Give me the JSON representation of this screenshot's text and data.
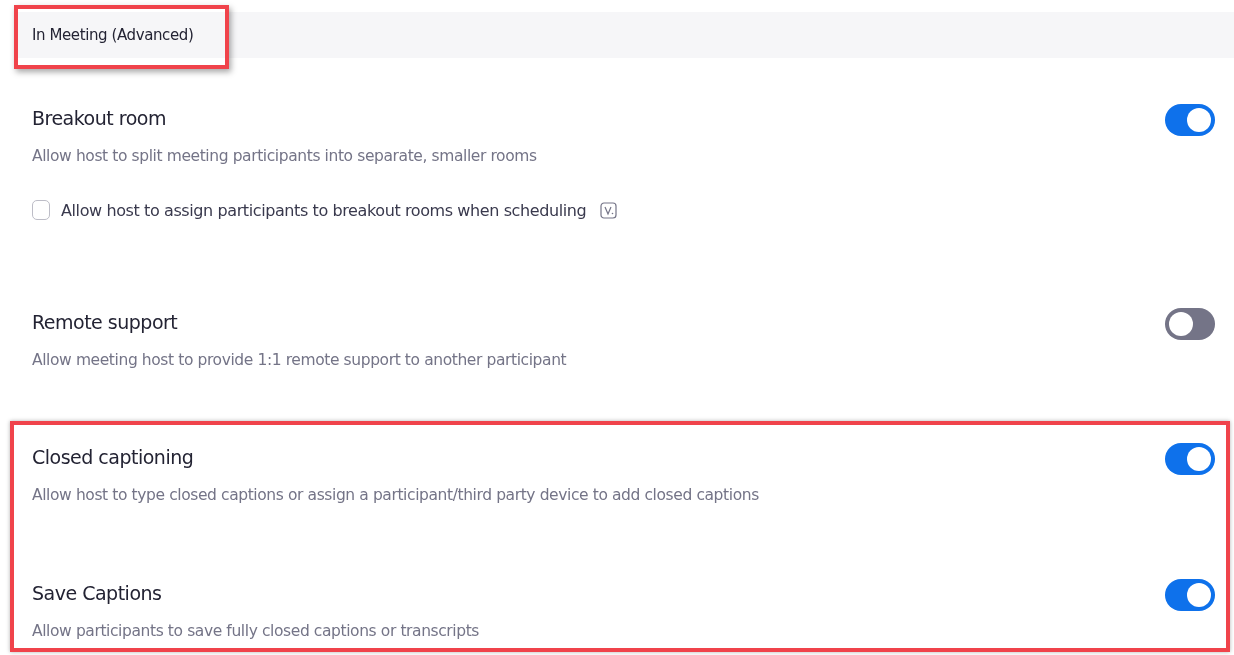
{
  "section_header": {
    "title": "In Meeting (Advanced)",
    "highlighted": true
  },
  "settings": [
    {
      "title": "Breakout room",
      "description": "Allow host to split meeting participants into separate, smaller rooms",
      "on": true,
      "highlighted": false,
      "options": [
        {
          "label": "Allow host to assign participants to breakout rooms when scheduling",
          "checked": false,
          "has_info_icon": true
        }
      ]
    },
    {
      "title": "Remote support",
      "description": "Allow meeting host to provide 1:1 remote support to another participant",
      "on": false,
      "highlighted": false
    },
    {
      "title": "Closed captioning",
      "description": "Allow host to type closed captions or assign a participant/third party device to add closed captions",
      "on": true,
      "highlighted": true
    },
    {
      "title": "Save Captions",
      "description": "Allow participants to save fully closed captions or transcripts",
      "on": true,
      "highlighted": true
    }
  ]
}
